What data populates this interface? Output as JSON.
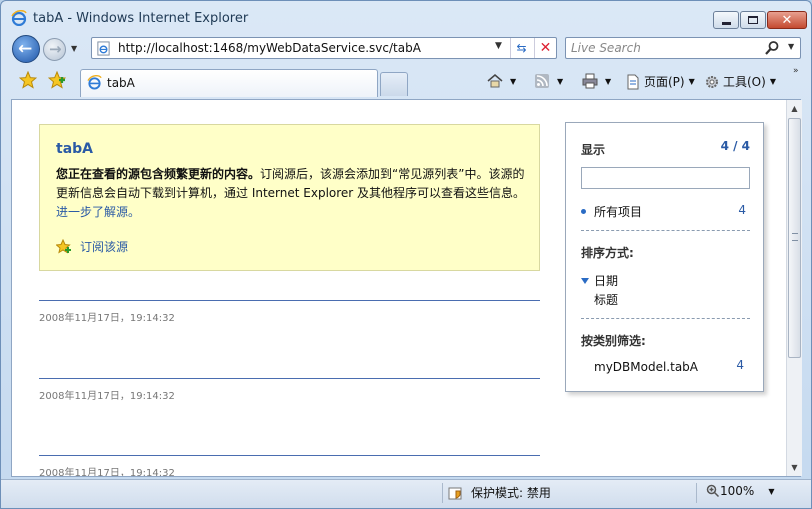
{
  "window": {
    "title": "tabA - Windows Internet Explorer"
  },
  "address": {
    "url": "http://localhost:1468/myWebDataService.svc/tabA"
  },
  "search": {
    "placeholder": "Live Search"
  },
  "tab": {
    "label": "tabA"
  },
  "commands": {
    "page": "页面(P)",
    "tools": "工具(O)"
  },
  "feed": {
    "title": "tabA",
    "body_bold": "您正在查看的源包含频繁更新的内容。",
    "body_text": "订阅源后，该源会添加到“常见源列表”中。该源的更新信息会自动下载到计算机，通过 Internet Explorer 及其他程序可以查看这些信息。",
    "learn_more": "进一步了解源。",
    "subscribe": "订阅该源",
    "entries": [
      {
        "date": "2008年11月17日，19:14:32"
      },
      {
        "date": "2008年11月17日，19:14:32"
      },
      {
        "date": "2008年11月17日，19:14:32"
      }
    ]
  },
  "sidebar": {
    "show_label": "显示",
    "show_count": "4 / 4",
    "all_items": "所有项目",
    "all_count": "4",
    "sort_label": "排序方式:",
    "sort_date": "日期",
    "sort_title": "标题",
    "category_label": "按类别筛选:",
    "category_item": "myDBModel.tabA",
    "category_count": "4"
  },
  "status": {
    "protected_mode": "保护模式: 禁用",
    "zoom": "100%"
  },
  "colors": {
    "link": "#2a5aa5",
    "infobox_bg": "#ffffc8"
  }
}
